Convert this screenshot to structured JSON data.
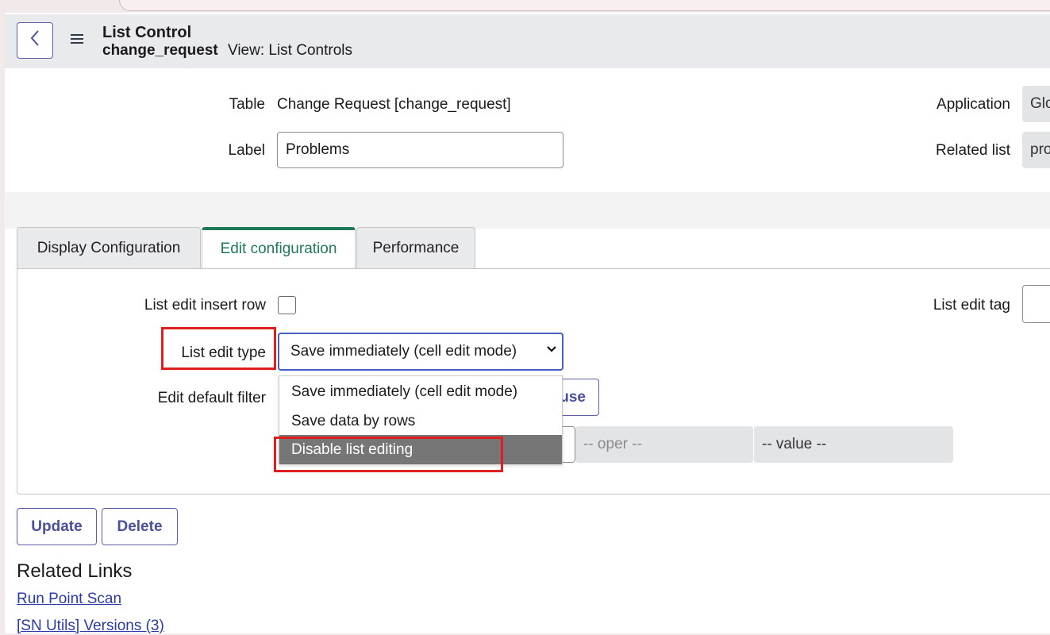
{
  "header": {
    "back_icon": "chevron-left-icon",
    "menu_icon": "hamburger-menu-icon",
    "title": "List Control",
    "record": "change_request",
    "view": "View: List Controls"
  },
  "form": {
    "table_label": "Table",
    "table_value": "Change Request [change_request]",
    "label_label": "Label",
    "label_value": "Problems",
    "application_label": "Application",
    "application_value": "Glo",
    "related_list_label": "Related list",
    "related_list_value": "pro"
  },
  "tabs": [
    {
      "label": "Display Configuration",
      "active": false
    },
    {
      "label": "Edit configuration",
      "active": true
    },
    {
      "label": "Performance",
      "active": false
    }
  ],
  "edit_config": {
    "insert_row_label": "List edit insert row",
    "insert_row_checked": false,
    "edit_tag_label": "List edit tag",
    "edit_type_label": "List edit type",
    "edit_type_selected": "Save immediately (cell edit mode)",
    "edit_type_options": [
      "Save immediately (cell edit mode)",
      "Save data by rows",
      "Disable list editing"
    ],
    "highlighted_option": "Disable list editing",
    "default_filter_label": "Edit default filter",
    "partial_button_text": "use",
    "oper_placeholder": "-- oper --",
    "value_placeholder": "-- value --"
  },
  "actions": {
    "update": "Update",
    "delete": "Delete"
  },
  "related_links": {
    "heading": "Related Links",
    "links": [
      "Run Point Scan",
      "[SN Utils] Versions (3)"
    ]
  },
  "colors": {
    "accent": "#1f7a5a",
    "button_border": "#5a5fa8",
    "highlight_red": "#e01e1e",
    "option_highlight": "#767676"
  }
}
